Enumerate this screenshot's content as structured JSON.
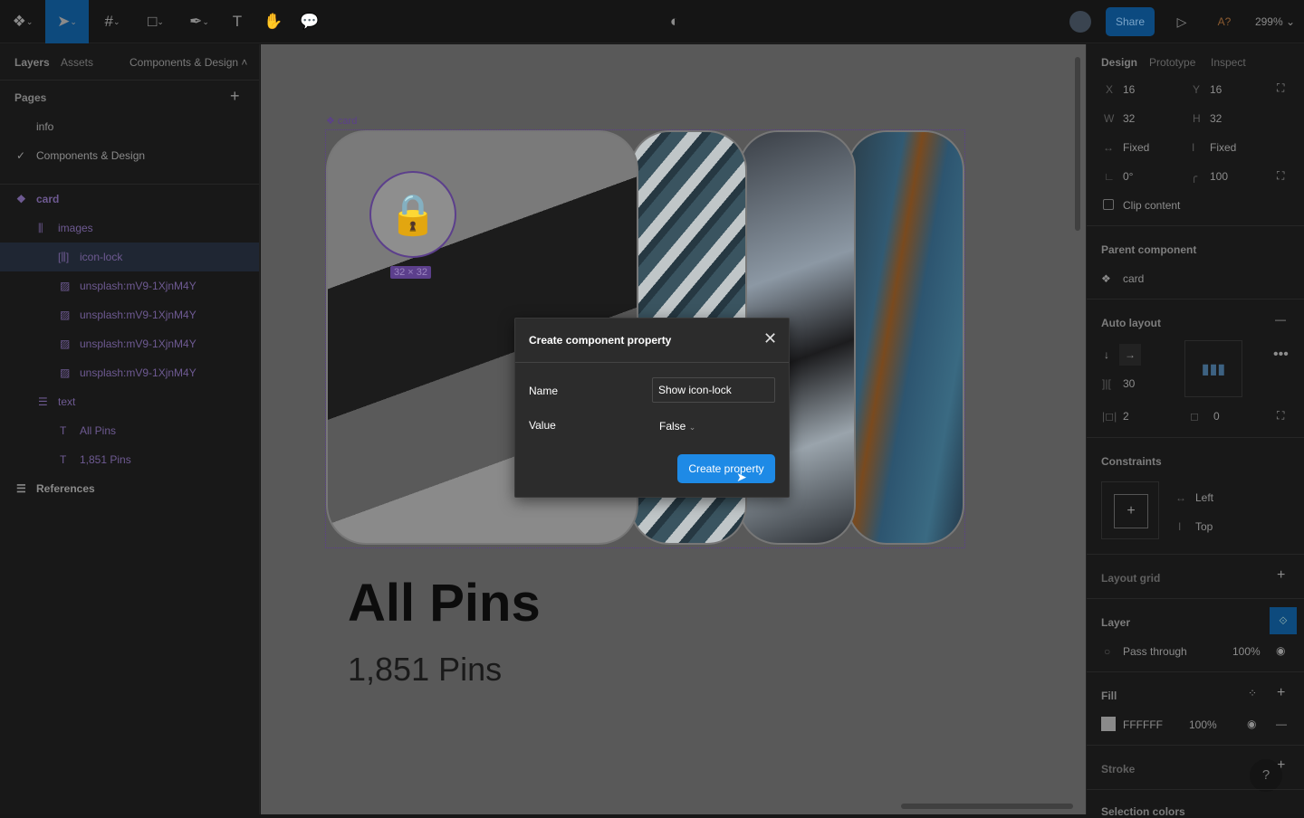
{
  "toolbar": {
    "share": "Share",
    "zoom": "299%",
    "a11y": "A?",
    "tools": [
      "figma-menu",
      "move",
      "frame",
      "shape",
      "pen",
      "text",
      "hand",
      "comment"
    ]
  },
  "left": {
    "tabs": [
      "Layers",
      "Assets"
    ],
    "page_switch": "Components & Design",
    "pages_title": "Pages",
    "pages": [
      "info",
      "Components & Design"
    ],
    "layers": [
      {
        "name": "card",
        "icon": "component"
      },
      {
        "name": "images",
        "icon": "auto-layout"
      },
      {
        "name": "icon-lock",
        "icon": "auto-layout"
      },
      {
        "name": "unsplash:mV9-1XjnM4Y",
        "icon": "image"
      },
      {
        "name": "unsplash:mV9-1XjnM4Y",
        "icon": "image"
      },
      {
        "name": "unsplash:mV9-1XjnM4Y",
        "icon": "image"
      },
      {
        "name": "unsplash:mV9-1XjnM4Y",
        "icon": "image"
      },
      {
        "name": "text",
        "icon": "auto-layout"
      },
      {
        "name": "All Pins",
        "icon": "text"
      },
      {
        "name": "1,851 Pins",
        "icon": "text"
      },
      {
        "name": "References",
        "icon": "auto-layout"
      }
    ]
  },
  "canvas": {
    "frame_label": "card",
    "size_badge": "32 × 32",
    "title": "All Pins",
    "subtitle": "1,851 Pins"
  },
  "dialog": {
    "title": "Create component property",
    "name_label": "Name",
    "name_value": "Show icon-lock",
    "value_label": "Value",
    "value_selected": "False",
    "create": "Create property"
  },
  "right": {
    "tabs": [
      "Design",
      "Prototype",
      "Inspect"
    ],
    "x_label": "X",
    "x": "16",
    "y_label": "Y",
    "y": "16",
    "w_label": "W",
    "w": "32",
    "h_label": "H",
    "h": "32",
    "hsize": "Fixed",
    "vsize": "Fixed",
    "rotation": "0°",
    "radius": "100",
    "clip": "Clip content",
    "parent_title": "Parent component",
    "parent": "card",
    "auto_title": "Auto layout",
    "spacing": "30",
    "padding_h": "2",
    "padding_v": "0",
    "constraints_title": "Constraints",
    "c_h": "Left",
    "c_v": "Top",
    "grid_title": "Layout grid",
    "layer_title": "Layer",
    "blend": "Pass through",
    "layer_opacity": "100%",
    "fill_title": "Fill",
    "fill_hex": "FFFFFF",
    "fill_opacity": "100%",
    "stroke_title": "Stroke",
    "selcolors_title": "Selection colors",
    "help": "?"
  },
  "colors": {
    "accent": "#0d4a7d",
    "share": "#0c4a80",
    "button": "#1e8ae6",
    "component": "#6a4a9c"
  }
}
